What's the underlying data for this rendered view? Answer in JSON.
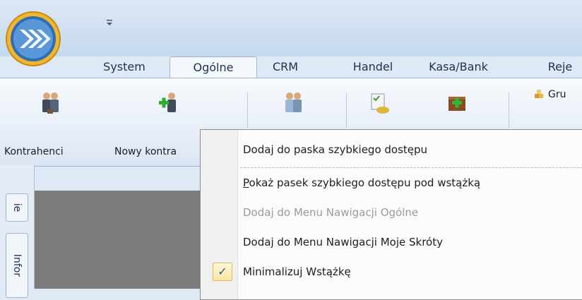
{
  "title_bar": {
    "qat_dropdown_icon": "qat-dropdown-icon"
  },
  "tabs": [
    {
      "label": "System"
    },
    {
      "label": "Ogólne",
      "active": true
    },
    {
      "label": "CRM"
    },
    {
      "label": "Handel"
    },
    {
      "label": "Kasa/Bank"
    },
    {
      "label": "Reje"
    }
  ],
  "ribbon": {
    "buttons": [
      {
        "label": "Kontrahenci",
        "icon": "contractors-icon"
      },
      {
        "label": "Nowy kontra",
        "icon": "new-contractor-icon"
      },
      {
        "label": "",
        "icon": "employees-icon"
      },
      {
        "label": "",
        "icon": "tasks-icon"
      },
      {
        "label": "",
        "icon": "new-item-box-icon"
      }
    ],
    "grupy_label": "Gru"
  },
  "sidebar": {
    "tabs": [
      {
        "label": "ie"
      },
      {
        "label": "Infor"
      }
    ]
  },
  "context_menu": {
    "items": [
      {
        "label": "Dodaj do paska szybkiego dostępu",
        "enabled": true,
        "checked": false
      },
      {
        "label": "Pokaż pasek szybkiego dostępu pod wstążką",
        "enabled": true,
        "checked": false,
        "accelerator": "P"
      },
      {
        "label": "Dodaj do Menu Nawigacji Ogólne",
        "enabled": false,
        "checked": false
      },
      {
        "label": "Dodaj do Menu Nawigacji Moje Skróty",
        "enabled": true,
        "checked": false
      },
      {
        "label": "Minimalizuj Wstążkę",
        "enabled": true,
        "checked": true
      }
    ],
    "check_glyph": "✓"
  },
  "colors": {
    "accent": "#2a55a4",
    "ribbon_border": "#9db4d3",
    "disabled_text": "#9a9a9a",
    "check_highlight": "#fde6a6"
  }
}
